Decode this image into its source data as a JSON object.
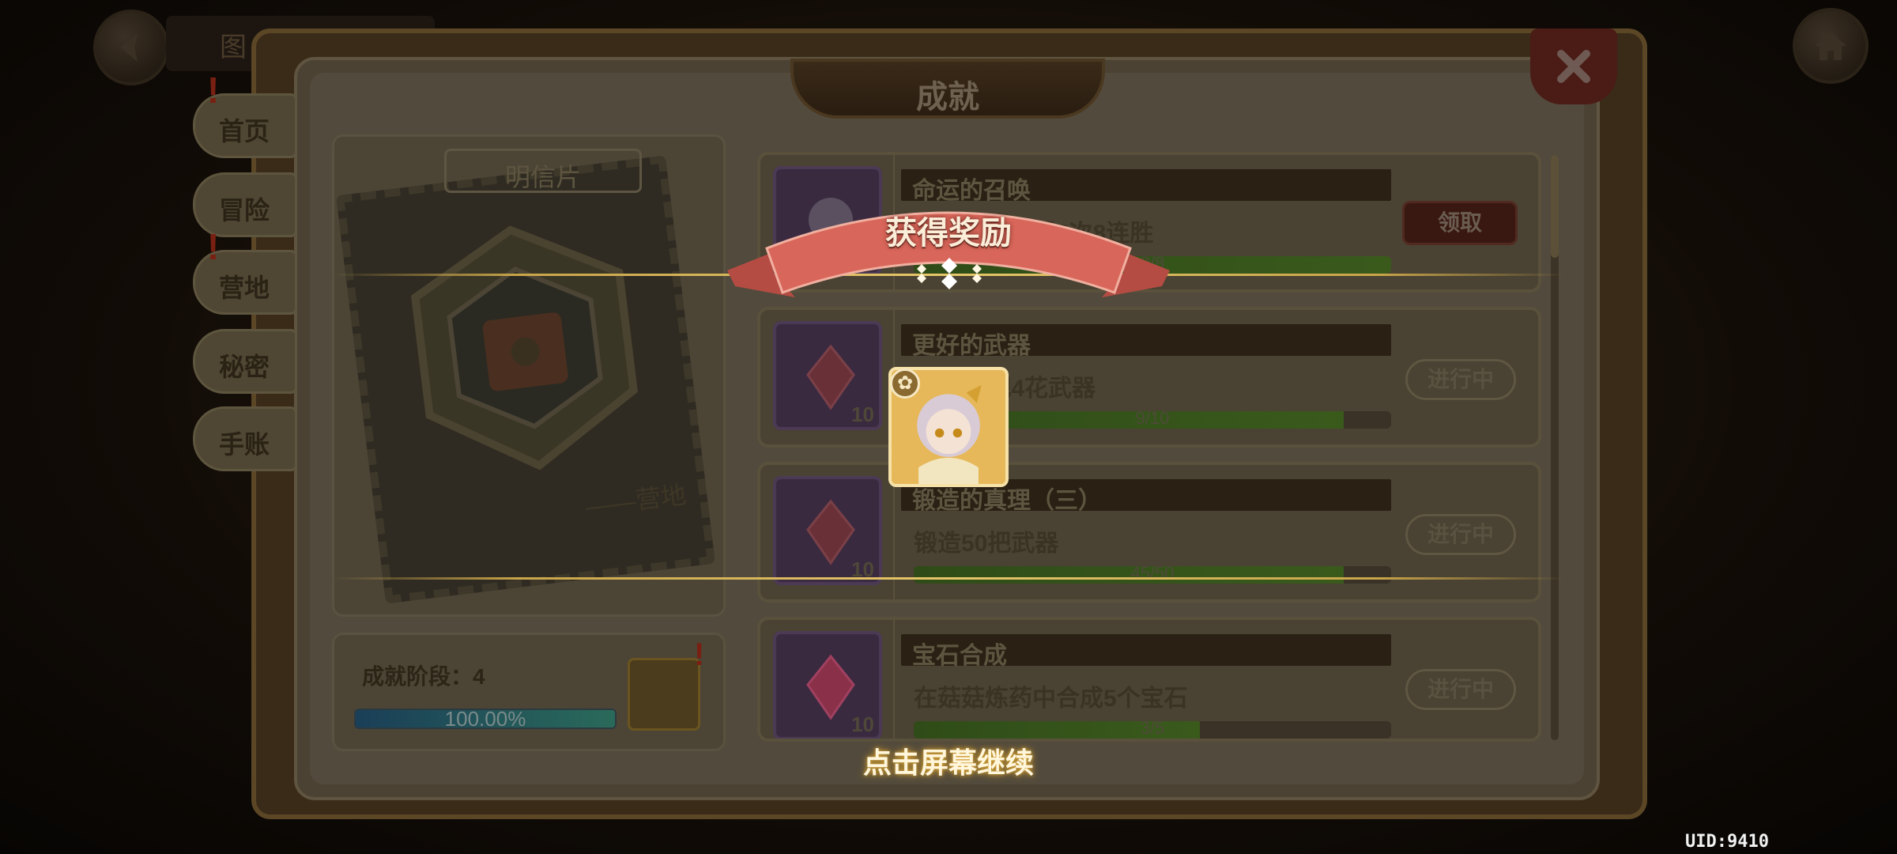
{
  "header": {
    "title": "成就",
    "top_label": "图"
  },
  "side_tabs": [
    {
      "label": "首页",
      "alert": true
    },
    {
      "label": "冒险",
      "alert": false
    },
    {
      "label": "营地",
      "alert": true
    },
    {
      "label": "秘密",
      "alert": false
    },
    {
      "label": "手账",
      "alert": false
    }
  ],
  "stamp": {
    "header": "明信片",
    "caption": "——营地"
  },
  "stage": {
    "label": "成就阶段：4",
    "progress_text": "100.00%",
    "progress": 1.0
  },
  "achievements": [
    {
      "title": "命运的召唤",
      "desc": "在竞技中获得8次8连胜",
      "progress_text": "8/8",
      "progress": 1.0,
      "status": "领取",
      "claimable": true,
      "count": ""
    },
    {
      "title": "更好的武器",
      "desc": "锻造10把4花武器",
      "progress_text": "9/10",
      "progress": 0.9,
      "status": "进行中",
      "claimable": false,
      "count": "10"
    },
    {
      "title": "锻造的真理（三）",
      "desc": "锻造50把武器",
      "progress_text": "45/50",
      "progress": 0.9,
      "status": "进行中",
      "claimable": false,
      "count": "10"
    },
    {
      "title": "宝石合成",
      "desc": "在菇菇炼药中合成5个宝石",
      "progress_text": "3/5",
      "progress": 0.6,
      "status": "进行中",
      "claimable": false,
      "count": "10"
    }
  ],
  "reward": {
    "title": "获得奖励",
    "continue": "点击屏幕继续"
  },
  "uid": "UID:9410",
  "colors": {
    "ribbon": "#d9665a",
    "gold_line": "#e6c76a",
    "continue_glow": "#d4a032"
  }
}
